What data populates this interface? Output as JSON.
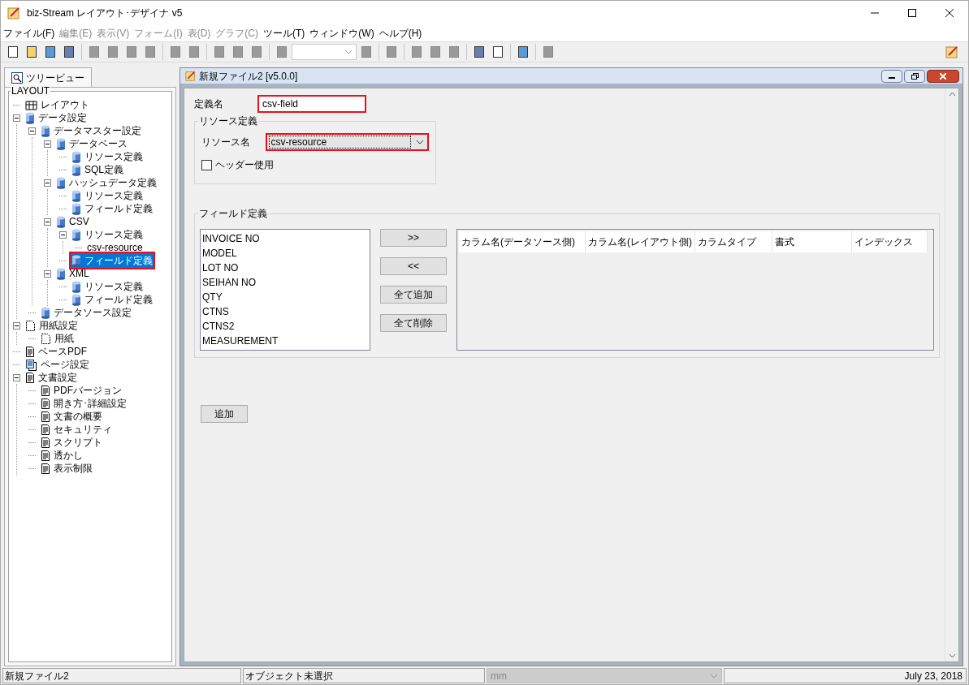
{
  "window": {
    "title": "biz-Stream レイアウト･デザイナ v5"
  },
  "menu": [
    {
      "label": "ファイル(F)",
      "disabled": false
    },
    {
      "label": "編集(E)",
      "disabled": true
    },
    {
      "label": "表示(V)",
      "disabled": true
    },
    {
      "label": "フォーム(I)",
      "disabled": true
    },
    {
      "label": "表(D)",
      "disabled": true
    },
    {
      "label": "グラフ(C)",
      "disabled": true
    },
    {
      "label": "ツール(T)",
      "disabled": false
    },
    {
      "label": "ウィンドウ(W)",
      "disabled": false
    },
    {
      "label": "ヘルプ(H)",
      "disabled": false
    }
  ],
  "toolbar": [
    {
      "kind": "button",
      "disabled": false
    },
    {
      "kind": "button",
      "disabled": false
    },
    {
      "kind": "button",
      "disabled": false
    },
    {
      "kind": "button",
      "disabled": false
    },
    {
      "kind": "separator"
    },
    {
      "kind": "button",
      "disabled": true
    },
    {
      "kind": "button",
      "disabled": true
    },
    {
      "kind": "button",
      "disabled": true
    },
    {
      "kind": "button",
      "disabled": true
    },
    {
      "kind": "separator"
    },
    {
      "kind": "button",
      "disabled": true
    },
    {
      "kind": "button",
      "disabled": true
    },
    {
      "kind": "separator"
    },
    {
      "kind": "button",
      "disabled": true
    },
    {
      "kind": "button",
      "disabled": true
    },
    {
      "kind": "button",
      "disabled": true
    },
    {
      "kind": "separator"
    },
    {
      "kind": "button",
      "disabled": true
    },
    {
      "kind": "combo",
      "disabled": true
    },
    {
      "kind": "button",
      "disabled": true
    },
    {
      "kind": "separator"
    },
    {
      "kind": "button",
      "disabled": true
    },
    {
      "kind": "separator"
    },
    {
      "kind": "button",
      "disabled": true
    },
    {
      "kind": "button",
      "disabled": true
    },
    {
      "kind": "button",
      "disabled": true
    },
    {
      "kind": "separator"
    },
    {
      "kind": "button",
      "disabled": false
    },
    {
      "kind": "button",
      "disabled": false
    },
    {
      "kind": "separator"
    },
    {
      "kind": "button",
      "disabled": false
    },
    {
      "kind": "separator"
    },
    {
      "kind": "button",
      "disabled": true
    }
  ],
  "left_panel": {
    "tab": {
      "label": "ツリービュー",
      "selected": true
    },
    "group_title": "LAYOUT",
    "tree": [
      {
        "label": "レイアウト",
        "kind": "layout",
        "selected": false,
        "highlighted": false
      },
      {
        "label": "データ設定",
        "kind": "db",
        "expanded": true,
        "selected": false,
        "highlighted": false,
        "children": [
          {
            "label": "データマスター設定",
            "kind": "db",
            "expanded": true,
            "selected": false,
            "highlighted": false,
            "children": [
              {
                "label": "データベース",
                "kind": "db",
                "expanded": true,
                "selected": false,
                "highlighted": false,
                "children": [
                  {
                    "label": "リソース定義",
                    "kind": "db",
                    "selected": false,
                    "highlighted": false
                  },
                  {
                    "label": "SQL定義",
                    "kind": "db",
                    "selected": false,
                    "highlighted": false
                  }
                ]
              },
              {
                "label": "ハッシュデータ定義",
                "kind": "db",
                "expanded": true,
                "selected": false,
                "highlighted": false,
                "children": [
                  {
                    "label": "リソース定義",
                    "kind": "db",
                    "selected": false,
                    "highlighted": false
                  },
                  {
                    "label": "フィールド定義",
                    "kind": "db",
                    "selected": false,
                    "highlighted": false
                  }
                ]
              },
              {
                "label": "CSV",
                "kind": "db",
                "expanded": true,
                "selected": false,
                "highlighted": false,
                "children": [
                  {
                    "label": "リソース定義",
                    "kind": "db",
                    "expanded": true,
                    "selected": false,
                    "highlighted": false,
                    "children": [
                      {
                        "label": "csv-resource",
                        "selected": false,
                        "highlighted": false
                      }
                    ]
                  },
                  {
                    "label": "フィールド定義",
                    "kind": "db",
                    "selected": true,
                    "highlighted": true
                  }
                ]
              },
              {
                "label": "XML",
                "kind": "db",
                "expanded": true,
                "selected": false,
                "highlighted": false,
                "children": [
                  {
                    "label": "リソース定義",
                    "kind": "db",
                    "selected": false,
                    "highlighted": false
                  },
                  {
                    "label": "フィールド定義",
                    "kind": "db",
                    "selected": false,
                    "highlighted": false
                  }
                ]
              }
            ]
          },
          {
            "label": "データソース設定",
            "kind": "db",
            "selected": false,
            "highlighted": false
          }
        ]
      },
      {
        "label": "用紙設定",
        "kind": "paper",
        "expanded": true,
        "selected": false,
        "highlighted": false,
        "children": [
          {
            "label": "用紙",
            "kind": "paper",
            "selected": false,
            "highlighted": false
          }
        ]
      },
      {
        "label": "ベースPDF",
        "kind": "doc",
        "selected": false,
        "highlighted": false
      },
      {
        "label": "ページ設定",
        "kind": "pages",
        "selected": false,
        "highlighted": false
      },
      {
        "label": "文書設定",
        "kind": "doc",
        "expanded": true,
        "selected": false,
        "highlighted": false,
        "children": [
          {
            "label": "PDFバージョン",
            "kind": "doc",
            "selected": false,
            "highlighted": false
          },
          {
            "label": "開き方･詳細設定",
            "kind": "doc",
            "selected": false,
            "highlighted": false
          },
          {
            "label": "文書の概要",
            "kind": "doc",
            "selected": false,
            "highlighted": false
          },
          {
            "label": "セキュリティ",
            "kind": "doc",
            "selected": false,
            "highlighted": false
          },
          {
            "label": "スクリプト",
            "kind": "doc",
            "selected": false,
            "highlighted": false
          },
          {
            "label": "透かし",
            "kind": "doc",
            "selected": false,
            "highlighted": false
          },
          {
            "label": "表示制限",
            "kind": "doc",
            "selected": false,
            "highlighted": false
          }
        ]
      }
    ]
  },
  "document": {
    "title": "新規ファイル2 [v5.0.0]",
    "definition_name": {
      "label": "定義名",
      "value": "csv-field",
      "highlighted": true
    },
    "resource_group": {
      "title": "リソース定義",
      "resource_label": "リソース名",
      "resource_value": "csv-resource",
      "resource_highlighted": true,
      "header_checkbox": {
        "label": "ヘッダー使用",
        "checked": false
      }
    },
    "field_group": {
      "title": "フィールド定義",
      "source_fields": [
        "INVOICE NO",
        "MODEL",
        "LOT NO",
        "SEIHAN NO",
        "QTY",
        "CTNS",
        "CTNS2",
        "MEASUREMENT"
      ],
      "buttons": [
        ">>",
        "<<",
        "全て追加",
        "全て削除"
      ],
      "columns": [
        "カラム名(データソース側)",
        "カラム名(レイアウト側)",
        "カラムタイプ",
        "書式",
        "インデックス"
      ]
    },
    "add_button": "追加"
  },
  "status_bar": {
    "file": "新規ファイル2",
    "selection": "オブジェクト未選択",
    "unit": "mm",
    "date": "July 23, 2018"
  }
}
